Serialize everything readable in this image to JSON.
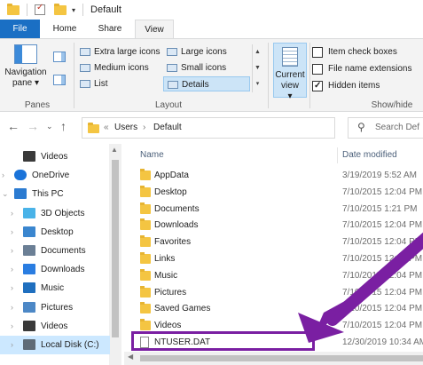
{
  "window": {
    "title": "Default"
  },
  "ribbon_tabs": {
    "file": "File",
    "home": "Home",
    "share": "Share",
    "view": "View"
  },
  "ribbon": {
    "navigation_pane": "Navigation pane",
    "navigation_pane_dropdown": "▾",
    "panes_label": "Panes",
    "layout_label": "Layout",
    "layout_items": {
      "extra_large": "Extra large icons",
      "large": "Large icons",
      "medium": "Medium icons",
      "small": "Small icons",
      "list": "List",
      "details": "Details"
    },
    "current_view": "Current view",
    "current_view_dropdown": "▾",
    "show_hide_label": "Show/hide",
    "checkboxes": {
      "item_check_boxes": "Item check boxes",
      "file_name_extensions": "File name extensions",
      "hidden_items": "Hidden items"
    },
    "checkbox_states": {
      "item_check_boxes": false,
      "file_name_extensions": false,
      "hidden_items": true
    }
  },
  "address": {
    "chevron": "«",
    "path": [
      "Users",
      "Default"
    ],
    "separator": "›",
    "search_placeholder": "Search Def"
  },
  "nav_tree": [
    {
      "label": "Videos",
      "icon": "videos-icon",
      "indent": 1,
      "chevron": ""
    },
    {
      "label": "OneDrive",
      "icon": "onedrive-icon",
      "indent": 0,
      "chevron": "›"
    },
    {
      "label": "This PC",
      "icon": "this-pc-icon",
      "indent": 0,
      "chevron": "⌄"
    },
    {
      "label": "3D Objects",
      "icon": "3d-objects-icon",
      "indent": 1,
      "chevron": "›"
    },
    {
      "label": "Desktop",
      "icon": "desktop-icon",
      "indent": 1,
      "chevron": "›"
    },
    {
      "label": "Documents",
      "icon": "documents-icon",
      "indent": 1,
      "chevron": "›"
    },
    {
      "label": "Downloads",
      "icon": "downloads-icon",
      "indent": 1,
      "chevron": "›"
    },
    {
      "label": "Music",
      "icon": "music-icon",
      "indent": 1,
      "chevron": "›"
    },
    {
      "label": "Pictures",
      "icon": "pictures-icon",
      "indent": 1,
      "chevron": "›"
    },
    {
      "label": "Videos",
      "icon": "videos-icon",
      "indent": 1,
      "chevron": "›"
    },
    {
      "label": "Local Disk (C:)",
      "icon": "local-disk-icon",
      "indent": 1,
      "chevron": "›",
      "selected": true
    }
  ],
  "columns": {
    "name": "Name",
    "date_modified": "Date modified"
  },
  "files": [
    {
      "name": "AppData",
      "date": "3/19/2019 5:52 AM",
      "type": "folder"
    },
    {
      "name": "Desktop",
      "date": "7/10/2015 12:04 PM",
      "type": "folder"
    },
    {
      "name": "Documents",
      "date": "7/10/2015 1:21 PM",
      "type": "folder"
    },
    {
      "name": "Downloads",
      "date": "7/10/2015 12:04 PM",
      "type": "folder"
    },
    {
      "name": "Favorites",
      "date": "7/10/2015 12:04 PM",
      "type": "folder"
    },
    {
      "name": "Links",
      "date": "7/10/2015 12:04 PM",
      "type": "folder"
    },
    {
      "name": "Music",
      "date": "7/10/2015 12:04 PM",
      "type": "folder"
    },
    {
      "name": "Pictures",
      "date": "7/10/2015 12:04 PM",
      "type": "folder"
    },
    {
      "name": "Saved Games",
      "date": "7/10/2015 12:04 PM",
      "type": "folder"
    },
    {
      "name": "Videos",
      "date": "7/10/2015 12:04 PM",
      "type": "folder"
    },
    {
      "name": "NTUSER.DAT",
      "date": "12/30/2019 10:34 AM",
      "type": "file",
      "highlighted": true
    }
  ],
  "colors": {
    "accent": "#1a6fc4",
    "annotation": "#7a1fa2",
    "folder": "#f4c542",
    "selection": "#cce8ff"
  }
}
